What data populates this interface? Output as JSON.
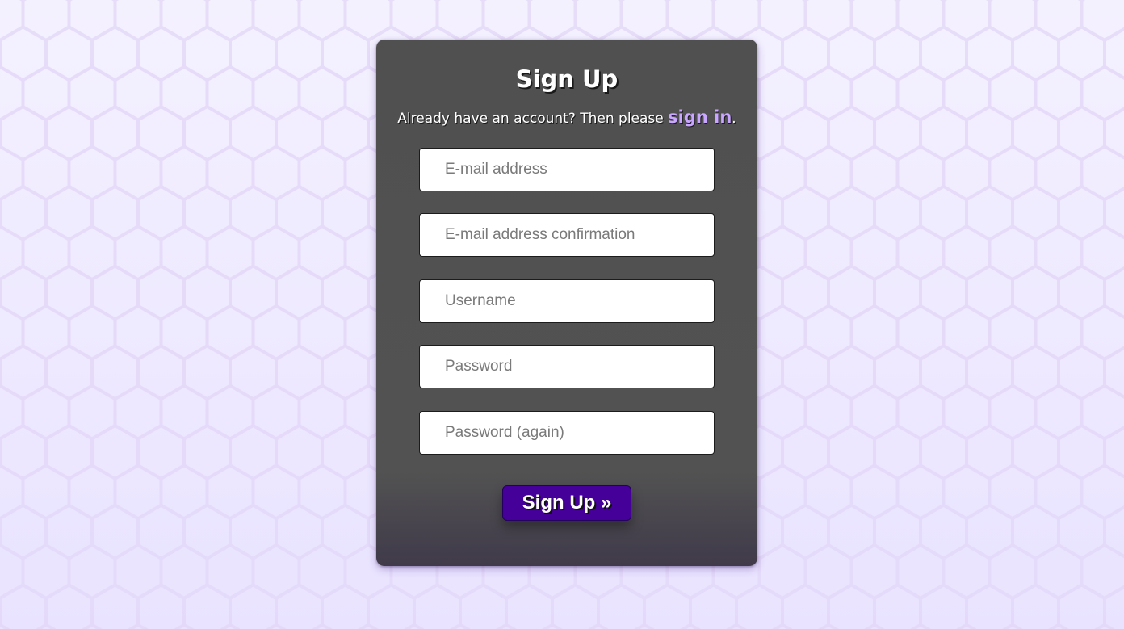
{
  "page": {
    "background_color": "#f0ecff",
    "hex_line_color": "#e2d6f7",
    "card_color": "#525252",
    "accent_color": "#46009a",
    "link_color": "#c9a6ff"
  },
  "form": {
    "title": "Sign Up",
    "subtitle_prefix": "Already have an account? Then please ",
    "signin_link": "sign in",
    "subtitle_suffix": ".",
    "fields": {
      "email_placeholder": "E-mail address",
      "email_confirm_placeholder": "E-mail address confirmation",
      "username_placeholder": "Username",
      "password_placeholder": "Password",
      "password_again_placeholder": "Password (again)"
    },
    "submit_label": "Sign Up »"
  }
}
